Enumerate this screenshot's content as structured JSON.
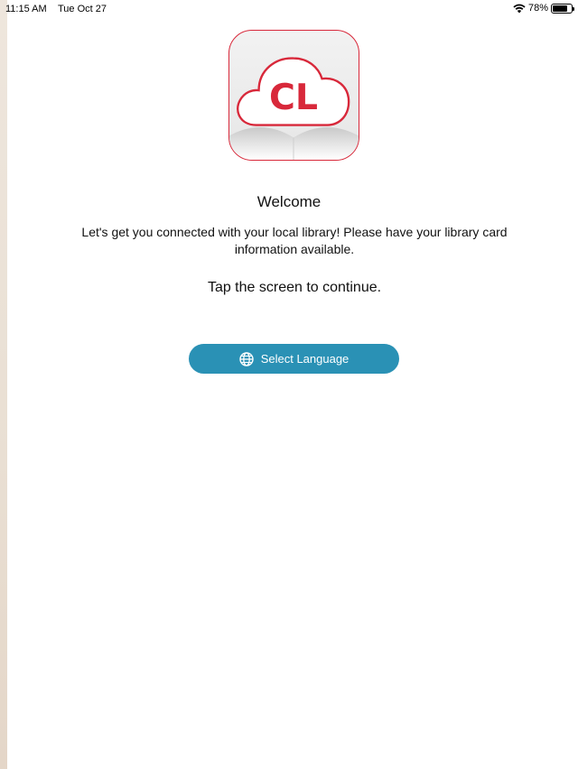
{
  "status_bar": {
    "time": "11:15 AM",
    "date": "Tue Oct 27",
    "battery_label": "78%",
    "battery_level": 0.78,
    "wifi_icon": "wifi-icon",
    "battery_icon": "battery-icon"
  },
  "logo": {
    "text": "CL",
    "brand_color": "#d8283a"
  },
  "welcome": {
    "title": "Welcome",
    "message": "Let's get you connected with your local library! Please have your library card information available.",
    "tap_prompt": "Tap the screen to continue."
  },
  "language_button": {
    "label": "Select Language",
    "icon": "globe-icon",
    "color": "#2a91b5"
  }
}
